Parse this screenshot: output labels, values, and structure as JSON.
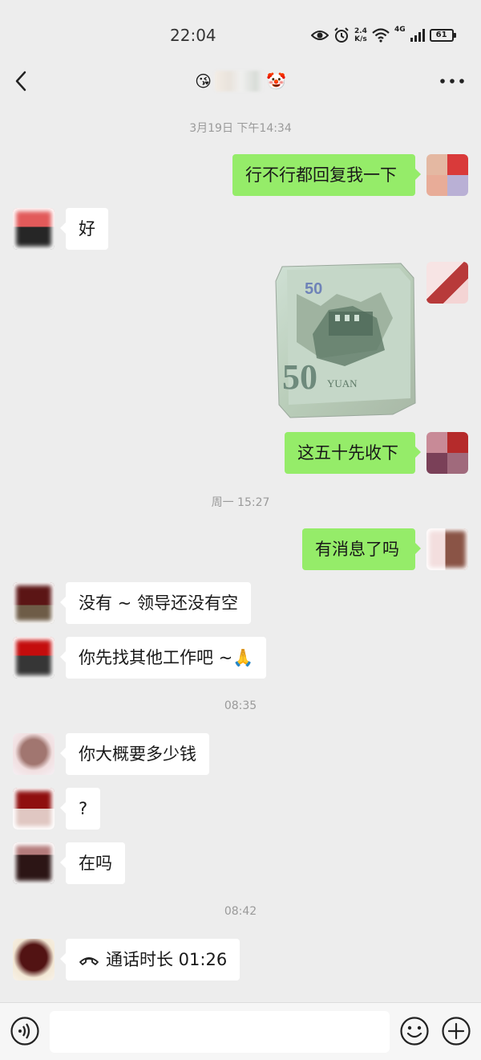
{
  "status_bar": {
    "time": "22:04",
    "net_speed_value": "2.4",
    "net_speed_unit": "K/s",
    "signal_gen": "4G",
    "battery": "61"
  },
  "header": {
    "title_emoji_left": "😘",
    "title_emoji_right": "🤡"
  },
  "messages": {
    "t1": "3月19日 下午14:34",
    "m1": "行不行都回复我一下",
    "m2": "好",
    "m3": "这五十先收下",
    "t2": "周一 15:27",
    "m4": "有消息了吗",
    "m5": "没有 ~ 领导还没有空",
    "m6": "你先找其他工作吧 ~",
    "m6_emoji": "🙏",
    "t3": "08:35",
    "m7": "你大概要多少钱",
    "m8": "?",
    "m9": "在吗",
    "t4": "08:42",
    "m10": "通话时长 01:26"
  },
  "photo": {
    "banknote_value": "50",
    "banknote_currency": "YUAN"
  },
  "input_bar": {
    "placeholder": ""
  },
  "colors": {
    "background": "#ededed",
    "outgoing_bubble": "#95ec69",
    "incoming_bubble": "#ffffff",
    "timestamp": "#9a9a9a"
  }
}
